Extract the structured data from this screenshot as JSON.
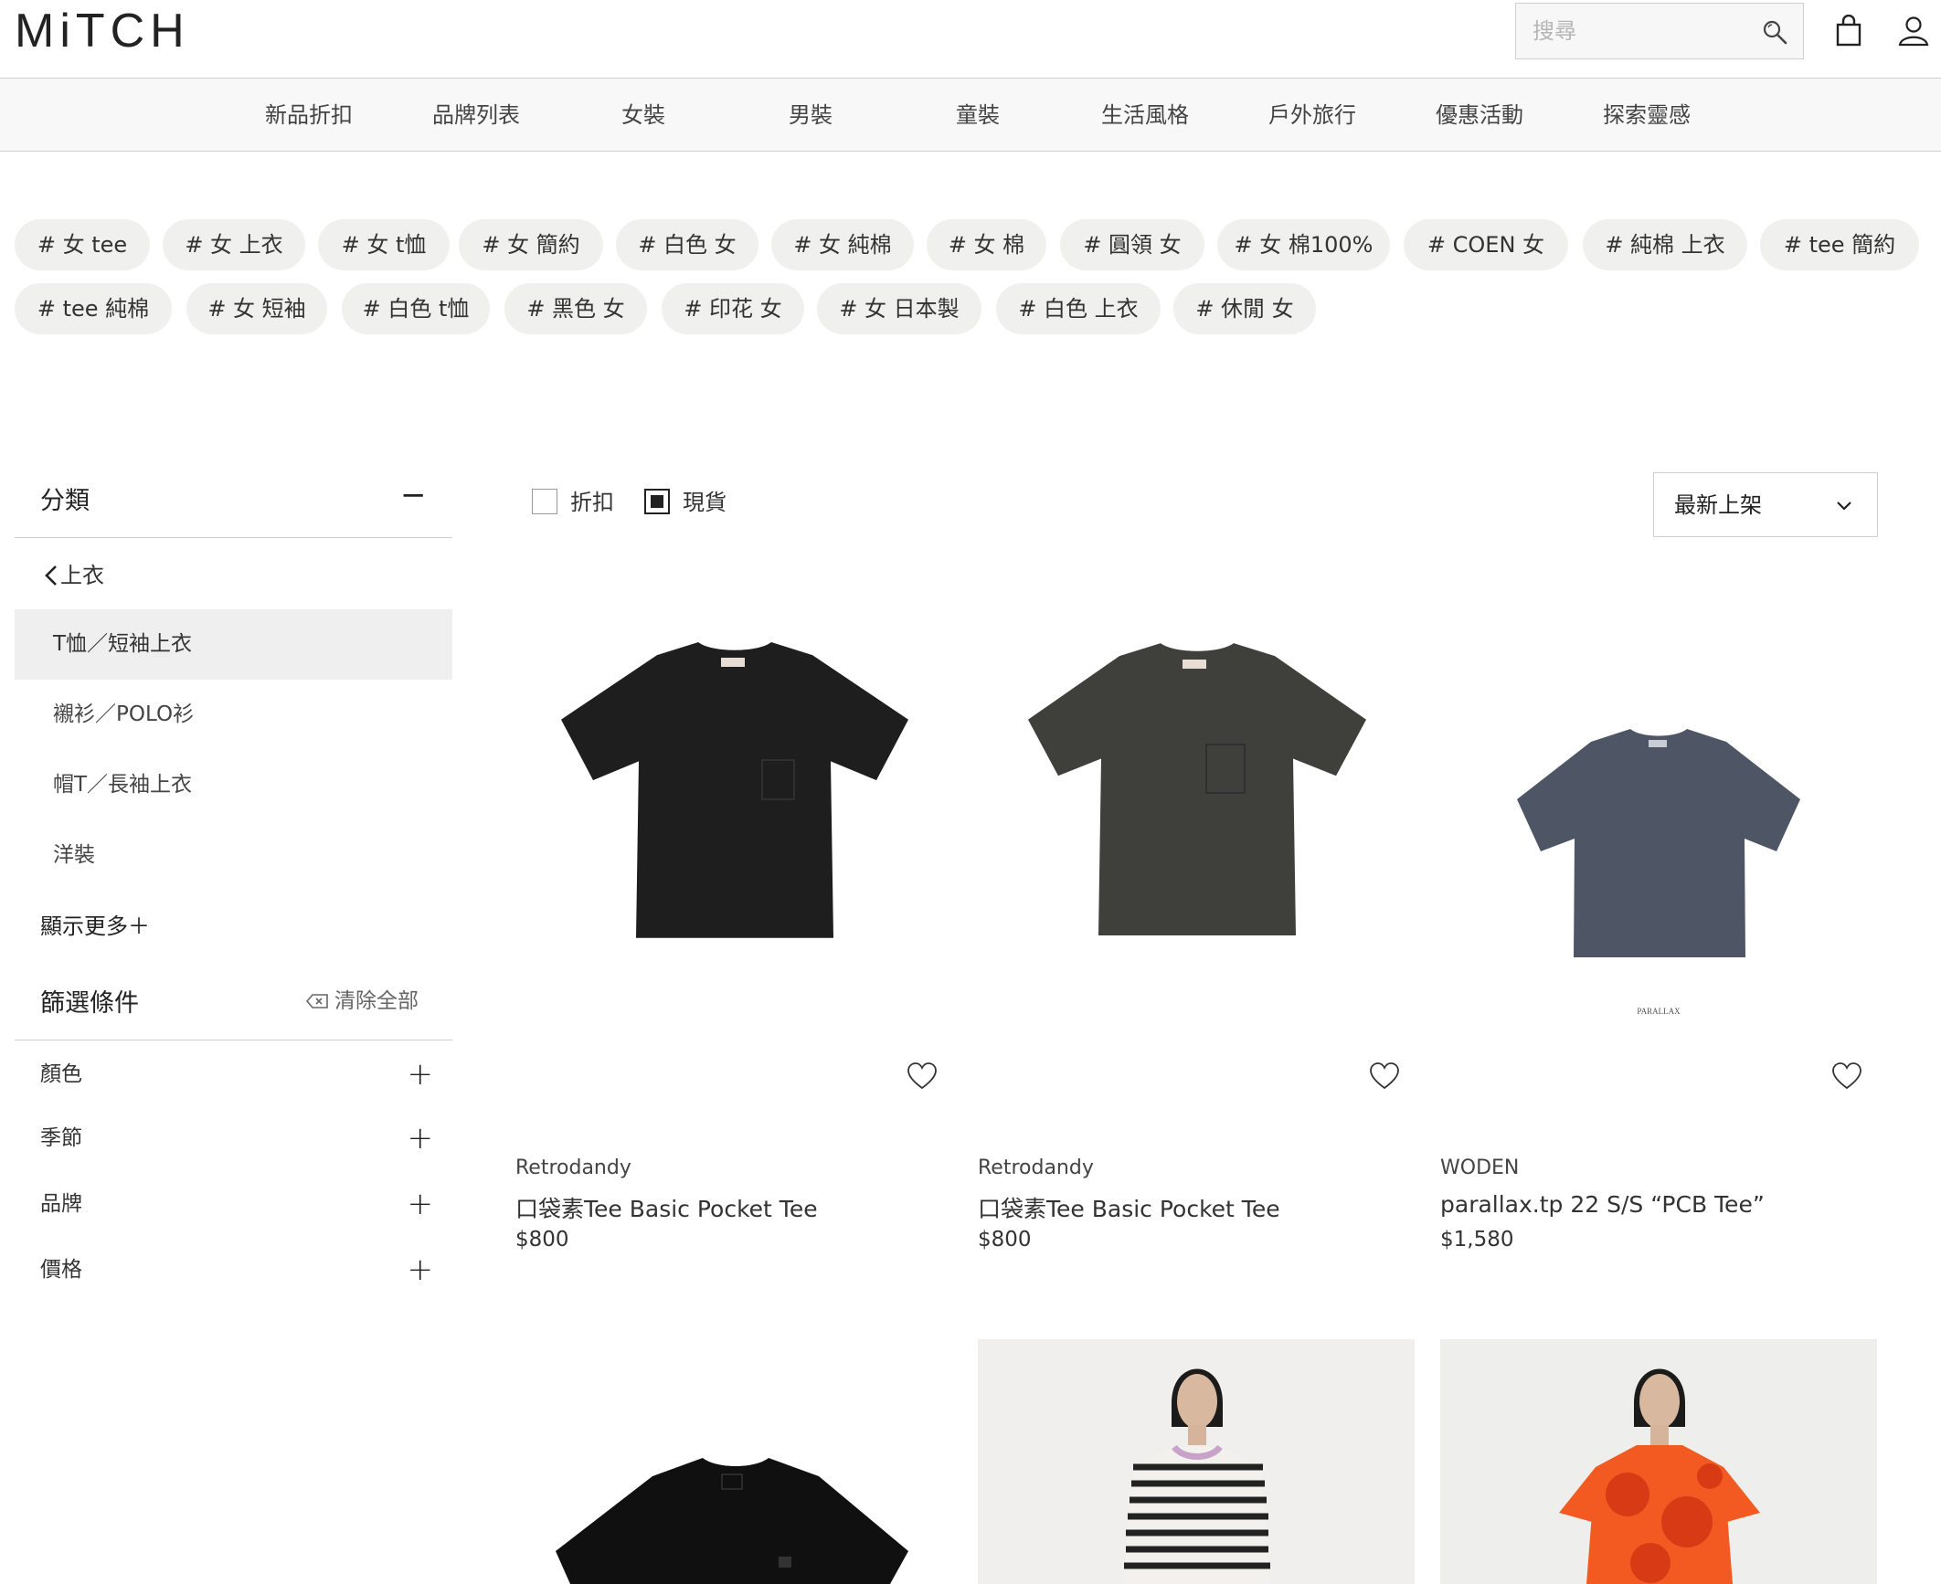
{
  "header": {
    "logo": "MiTCH",
    "search_placeholder": "搜尋"
  },
  "nav": {
    "items": [
      "新品折扣",
      "品牌列表",
      "女裝",
      "男裝",
      "童裝",
      "生活風格",
      "戶外旅行",
      "優惠活動",
      "探索靈感"
    ]
  },
  "tags": {
    "row1": [
      "# 女 tee",
      "# 女 上衣",
      "# 女 t恤",
      "# 女 簡約",
      "# 白色 女",
      "# 女 純棉",
      "# 女 棉",
      "# 圓領 女",
      "# 女 棉100%",
      "# COEN 女",
      "# 純棉 上衣",
      "# tee 簡約"
    ],
    "row2": [
      "# tee 純棉",
      "# 女 短袖",
      "# 白色 t恤",
      "# 黑色 女",
      "# 印花 女",
      "# 女 日本製",
      "# 白色 上衣",
      "# 休閒 女"
    ]
  },
  "sidebar": {
    "category_title": "分類",
    "collapse_symbol": "−",
    "back_label": "上衣",
    "categories": [
      "T恤／短袖上衣",
      "襯衫／POLO衫",
      "帽T／長袖上衣",
      "洋裝"
    ],
    "active_category": "T恤／短袖上衣",
    "show_more": "顯示更多＋",
    "filter_title": "篩選條件",
    "clear_all": "清除全部",
    "filters": [
      "顏色",
      "季節",
      "品牌",
      "價格"
    ],
    "expand_symbol": "+"
  },
  "filter_bar": {
    "discount_label": "折扣",
    "discount_checked": false,
    "in_stock_label": "現貨",
    "in_stock_checked": true,
    "sort_value": "最新上架"
  },
  "products": [
    {
      "brand": "Retrodandy",
      "name": "口袋素Tee Basic Pocket Tee",
      "price": "$800",
      "image": "black-pocket-tee",
      "color": "#1e1e1e"
    },
    {
      "brand": "Retrodandy",
      "name": "口袋素Tee Basic Pocket Tee",
      "price": "$800",
      "image": "charcoal-pocket-tee",
      "color": "#3f403c"
    },
    {
      "brand": "WODEN",
      "name": "parallax.tp 22 S/S “PCB Tee”",
      "price": "$1,580",
      "image": "slate-blue-tee",
      "color": "#4e5666",
      "image_caption": "PARALLAX"
    }
  ],
  "more_products": [
    {
      "image": "black-tee",
      "color": "#101010"
    },
    {
      "image": "model-striped-tee",
      "color": "#f0efed"
    },
    {
      "image": "model-orange-floral-tee",
      "color": "#eeeeec"
    }
  ],
  "colors": {
    "border": "#cfcfcf",
    "nav_bg": "#f8f8f8",
    "tag_bg": "#f0f0ee",
    "active_bg": "#efefef",
    "text": "#222222"
  }
}
